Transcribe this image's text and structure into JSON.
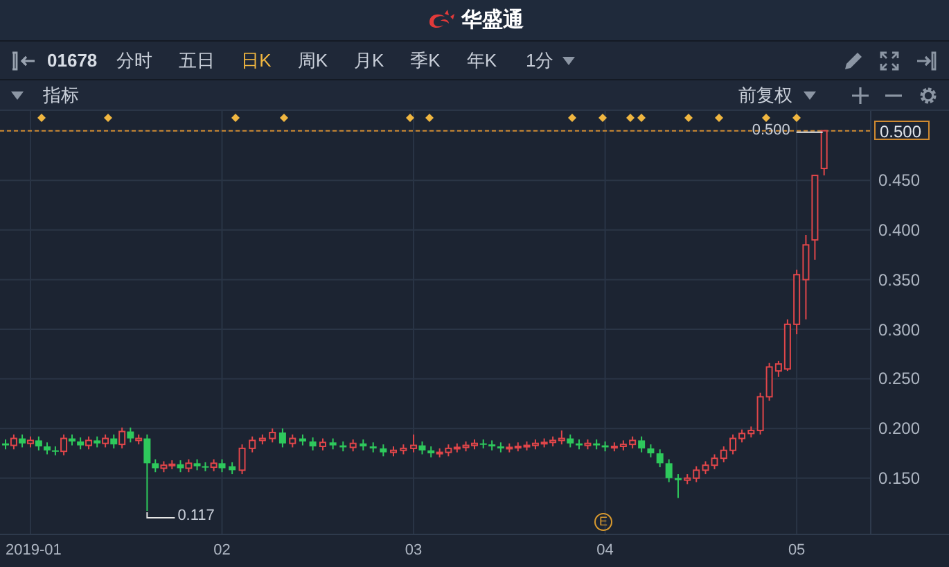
{
  "header": {
    "logo_text": "华盛通"
  },
  "toolbar": {
    "stock_code": "01678",
    "periods": [
      {
        "label": "分时",
        "selected": false
      },
      {
        "label": "五日",
        "selected": false
      },
      {
        "label": "日K",
        "selected": true
      },
      {
        "label": "周K",
        "selected": false
      },
      {
        "label": "月K",
        "selected": false
      },
      {
        "label": "季K",
        "selected": false
      },
      {
        "label": "年K",
        "selected": false
      }
    ],
    "interval": "1分"
  },
  "indicator_bar": {
    "label": "指标",
    "adjustment": "前复权"
  },
  "chart": {
    "high_label": "0.500",
    "low_label": "0.117",
    "event_marker": "E",
    "chart_data": {
      "type": "candlestick",
      "ylim": [
        0.094,
        0.52
      ],
      "xlim": [
        0.841,
        5.795
      ],
      "grid": true,
      "ref_lines": [
        {
          "axis": "y",
          "value": 0.5,
          "color": "#d08a30"
        }
      ],
      "x": [
        0.87,
        0.913,
        0.957,
        1,
        1.043,
        1.087,
        1.13,
        1.174,
        1.217,
        1.261,
        1.304,
        1.348,
        1.391,
        1.435,
        1.478,
        1.522,
        1.565,
        1.609,
        1.652,
        1.696,
        1.739,
        1.783,
        1.826,
        1.87,
        1.913,
        1.957,
        2,
        2.053,
        2.105,
        2.158,
        2.211,
        2.263,
        2.316,
        2.368,
        2.421,
        2.474,
        2.526,
        2.579,
        2.632,
        2.684,
        2.737,
        2.789,
        2.842,
        2.895,
        2.947,
        3,
        3.045,
        3.091,
        3.136,
        3.182,
        3.227,
        3.273,
        3.318,
        3.364,
        3.409,
        3.455,
        3.5,
        3.545,
        3.591,
        3.636,
        3.682,
        3.727,
        3.773,
        3.818,
        3.864,
        3.909,
        3.955,
        4,
        4.048,
        4.095,
        4.143,
        4.19,
        4.238,
        4.286,
        4.333,
        4.381,
        4.429,
        4.476,
        4.524,
        4.571,
        4.619,
        4.667,
        4.714,
        4.762,
        4.81,
        4.857,
        4.905,
        4.952,
        5,
        5.048,
        5.095,
        5.143
      ],
      "xticks": [
        {
          "value": 1,
          "label": "2019-01"
        },
        {
          "value": 2,
          "label": "02"
        },
        {
          "value": 3,
          "label": "03"
        },
        {
          "value": 4,
          "label": "04"
        },
        {
          "value": 5,
          "label": "05"
        }
      ],
      "yticks": [
        {
          "value": 0.5,
          "label": "0.500"
        },
        {
          "value": 0.45,
          "label": "0.450"
        },
        {
          "value": 0.4,
          "label": "0.400"
        },
        {
          "value": 0.35,
          "label": "0.350"
        },
        {
          "value": 0.3,
          "label": "0.300"
        },
        {
          "value": 0.25,
          "label": "0.250"
        },
        {
          "value": 0.2,
          "label": "0.200"
        },
        {
          "value": 0.15,
          "label": "0.150"
        }
      ],
      "ohlc": [
        [
          0.185,
          0.189,
          0.179,
          0.183
        ],
        [
          0.183,
          0.194,
          0.179,
          0.19
        ],
        [
          0.19,
          0.194,
          0.181,
          0.185
        ],
        [
          0.185,
          0.192,
          0.181,
          0.188
        ],
        [
          0.188,
          0.192,
          0.178,
          0.182
        ],
        [
          0.182,
          0.186,
          0.174,
          0.178
        ],
        [
          0.178,
          0.182,
          0.173,
          0.177
        ],
        [
          0.177,
          0.194,
          0.173,
          0.19
        ],
        [
          0.19,
          0.194,
          0.183,
          0.187
        ],
        [
          0.187,
          0.191,
          0.179,
          0.183
        ],
        [
          0.183,
          0.192,
          0.179,
          0.188
        ],
        [
          0.188,
          0.192,
          0.181,
          0.185
        ],
        [
          0.185,
          0.194,
          0.181,
          0.19
        ],
        [
          0.19,
          0.194,
          0.18,
          0.184
        ],
        [
          0.184,
          0.201,
          0.18,
          0.197
        ],
        [
          0.197,
          0.201,
          0.186,
          0.19
        ],
        [
          0.188,
          0.194,
          0.184,
          0.19
        ],
        [
          0.19,
          0.194,
          0.117,
          0.165
        ],
        [
          0.165,
          0.169,
          0.156,
          0.16
        ],
        [
          0.16,
          0.167,
          0.156,
          0.163
        ],
        [
          0.163,
          0.168,
          0.159,
          0.164
        ],
        [
          0.164,
          0.168,
          0.156,
          0.16
        ],
        [
          0.16,
          0.169,
          0.156,
          0.165
        ],
        [
          0.165,
          0.169,
          0.158,
          0.162
        ],
        [
          0.162,
          0.166,
          0.157,
          0.161
        ],
        [
          0.161,
          0.169,
          0.157,
          0.165
        ],
        [
          0.165,
          0.169,
          0.156,
          0.16
        ],
        [
          0.162,
          0.166,
          0.154,
          0.158
        ],
        [
          0.158,
          0.184,
          0.154,
          0.18
        ],
        [
          0.18,
          0.192,
          0.176,
          0.188
        ],
        [
          0.188,
          0.194,
          0.184,
          0.19
        ],
        [
          0.19,
          0.2,
          0.186,
          0.196
        ],
        [
          0.196,
          0.2,
          0.181,
          0.185
        ],
        [
          0.185,
          0.194,
          0.181,
          0.19
        ],
        [
          0.19,
          0.194,
          0.183,
          0.187
        ],
        [
          0.187,
          0.191,
          0.178,
          0.182
        ],
        [
          0.182,
          0.19,
          0.178,
          0.186
        ],
        [
          0.186,
          0.19,
          0.179,
          0.183
        ],
        [
          0.183,
          0.187,
          0.177,
          0.181
        ],
        [
          0.181,
          0.189,
          0.177,
          0.185
        ],
        [
          0.185,
          0.189,
          0.178,
          0.182
        ],
        [
          0.182,
          0.186,
          0.176,
          0.18
        ],
        [
          0.18,
          0.184,
          0.172,
          0.176
        ],
        [
          0.176,
          0.182,
          0.172,
          0.178
        ],
        [
          0.178,
          0.184,
          0.174,
          0.18
        ],
        [
          0.18,
          0.194,
          0.176,
          0.183
        ],
        [
          0.183,
          0.187,
          0.174,
          0.178
        ],
        [
          0.178,
          0.182,
          0.171,
          0.175
        ],
        [
          0.175,
          0.18,
          0.171,
          0.176
        ],
        [
          0.176,
          0.184,
          0.172,
          0.18
        ],
        [
          0.18,
          0.185,
          0.176,
          0.181
        ],
        [
          0.181,
          0.187,
          0.177,
          0.183
        ],
        [
          0.183,
          0.189,
          0.179,
          0.185
        ],
        [
          0.185,
          0.189,
          0.18,
          0.184
        ],
        [
          0.184,
          0.188,
          0.178,
          0.182
        ],
        [
          0.182,
          0.186,
          0.176,
          0.18
        ],
        [
          0.18,
          0.185,
          0.176,
          0.181
        ],
        [
          0.181,
          0.186,
          0.177,
          0.182
        ],
        [
          0.182,
          0.187,
          0.178,
          0.183
        ],
        [
          0.183,
          0.189,
          0.179,
          0.185
        ],
        [
          0.185,
          0.19,
          0.181,
          0.186
        ],
        [
          0.186,
          0.192,
          0.182,
          0.188
        ],
        [
          0.188,
          0.198,
          0.184,
          0.19
        ],
        [
          0.19,
          0.194,
          0.181,
          0.185
        ],
        [
          0.185,
          0.189,
          0.179,
          0.183
        ],
        [
          0.183,
          0.189,
          0.179,
          0.185
        ],
        [
          0.185,
          0.189,
          0.179,
          0.183
        ],
        [
          0.183,
          0.187,
          0.177,
          0.181
        ],
        [
          0.181,
          0.186,
          0.177,
          0.182
        ],
        [
          0.182,
          0.188,
          0.178,
          0.184
        ],
        [
          0.184,
          0.192,
          0.18,
          0.188
        ],
        [
          0.188,
          0.192,
          0.176,
          0.18
        ],
        [
          0.18,
          0.184,
          0.171,
          0.175
        ],
        [
          0.175,
          0.179,
          0.161,
          0.165
        ],
        [
          0.165,
          0.169,
          0.146,
          0.15
        ],
        [
          0.15,
          0.154,
          0.13,
          0.148
        ],
        [
          0.148,
          0.154,
          0.144,
          0.15
        ],
        [
          0.15,
          0.162,
          0.146,
          0.158
        ],
        [
          0.158,
          0.167,
          0.154,
          0.163
        ],
        [
          0.163,
          0.174,
          0.159,
          0.17
        ],
        [
          0.17,
          0.182,
          0.166,
          0.178
        ],
        [
          0.178,
          0.194,
          0.174,
          0.19
        ],
        [
          0.19,
          0.199,
          0.186,
          0.195
        ],
        [
          0.195,
          0.202,
          0.191,
          0.198
        ],
        [
          0.198,
          0.236,
          0.194,
          0.232
        ],
        [
          0.232,
          0.266,
          0.228,
          0.262
        ],
        [
          0.258,
          0.268,
          0.252,
          0.265
        ],
        [
          0.26,
          0.31,
          0.258,
          0.305
        ],
        [
          0.305,
          0.36,
          0.295,
          0.355
        ],
        [
          0.35,
          0.395,
          0.31,
          0.385
        ],
        [
          0.39,
          0.455,
          0.37,
          0.455
        ],
        [
          0.462,
          0.5,
          0.455,
          0.5
        ]
      ]
    }
  }
}
